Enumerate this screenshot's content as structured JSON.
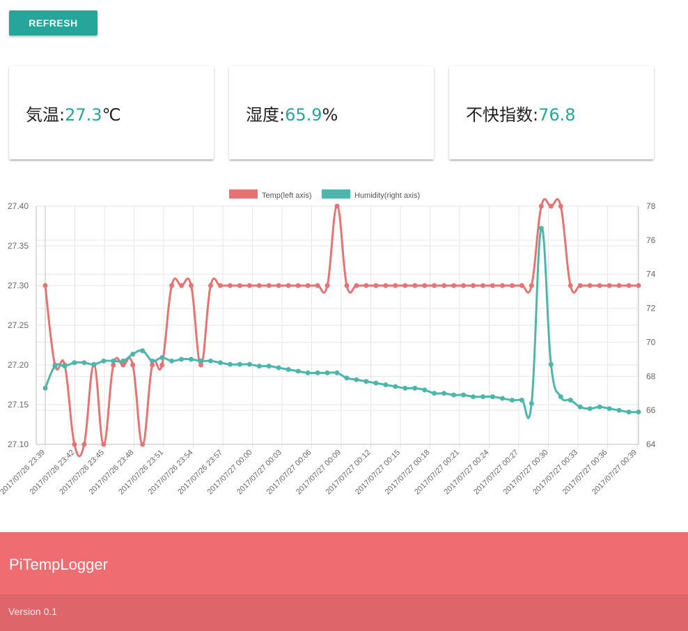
{
  "toolbar": {
    "refresh_label": "REFRESH"
  },
  "cards": {
    "temp": {
      "label": "気温:",
      "value": "27.3",
      "unit": "℃"
    },
    "humidity": {
      "label": "湿度:",
      "value": "65.9",
      "unit": "%"
    },
    "discomfort": {
      "label": "不快指数:",
      "value": "76.8",
      "unit": ""
    }
  },
  "footer": {
    "title": "PiTempLogger",
    "version": "Version 0.1"
  },
  "colors": {
    "accent": "#26a69a",
    "temp_series": "#e57373",
    "humidity_series": "#4db6ac",
    "footer": "#ef6c70",
    "footer_copy": "#de666a"
  },
  "chart_data": {
    "type": "line",
    "title": "",
    "legend": "top-center",
    "grid": true,
    "x_tick_labels": [
      "2017/07/26 23:39",
      "2017/07/26 23:42",
      "2017/07/26 23:45",
      "2017/07/26 23:48",
      "2017/07/26 23:51",
      "2017/07/26 23:54",
      "2017/07/26 23:57",
      "2017/07/27 00:00",
      "2017/07/27 00:03",
      "2017/07/27 00:06",
      "2017/07/27 00:09",
      "2017/07/27 00:12",
      "2017/07/27 00:15",
      "2017/07/27 00:18",
      "2017/07/27 00:21",
      "2017/07/27 00:24",
      "2017/07/27 00:27",
      "2017/07/27 00:30",
      "2017/07/27 00:33",
      "2017/07/27 00:36",
      "2017/07/27 00:39"
    ],
    "y_left": {
      "ticks": [
        "27.40",
        "27.35",
        "27.30",
        "27.25",
        "27.20",
        "27.15",
        "27.10"
      ],
      "ylim": [
        27.1,
        27.4
      ]
    },
    "y_right": {
      "ticks": [
        "78",
        "76",
        "74",
        "72",
        "70",
        "68",
        "66",
        "64"
      ],
      "ylim": [
        64,
        78
      ]
    },
    "series": [
      {
        "name": "Temp(left axis)",
        "axis": "left",
        "values": [
          27.3,
          27.2,
          27.2,
          27.1,
          27.1,
          27.2,
          27.1,
          27.2,
          27.2,
          27.2,
          27.1,
          27.2,
          27.2,
          27.3,
          27.3,
          27.3,
          27.2,
          27.3,
          27.3,
          27.3,
          27.3,
          27.3,
          27.3,
          27.3,
          27.3,
          27.3,
          27.3,
          27.3,
          27.3,
          27.3,
          27.4,
          27.3,
          27.3,
          27.3,
          27.3,
          27.3,
          27.3,
          27.3,
          27.3,
          27.3,
          27.3,
          27.3,
          27.3,
          27.3,
          27.3,
          27.3,
          27.3,
          27.3,
          27.3,
          27.3,
          27.3,
          27.4,
          27.4,
          27.4,
          27.3,
          27.3,
          27.3,
          27.3,
          27.3,
          27.3,
          27.3,
          27.3
        ]
      },
      {
        "name": "Humidity(right axis)",
        "axis": "right",
        "values": [
          67.3,
          68.6,
          68.6,
          68.8,
          68.8,
          68.7,
          68.9,
          68.9,
          68.9,
          69.3,
          69.5,
          68.9,
          69.1,
          68.9,
          69.0,
          69.0,
          68.9,
          68.9,
          68.8,
          68.7,
          68.7,
          68.7,
          68.6,
          68.6,
          68.5,
          68.4,
          68.3,
          68.2,
          68.2,
          68.2,
          68.2,
          67.9,
          67.8,
          67.7,
          67.6,
          67.5,
          67.4,
          67.3,
          67.3,
          67.2,
          67.0,
          67.0,
          66.9,
          66.9,
          66.8,
          66.8,
          66.8,
          66.7,
          66.6,
          66.6,
          66.4,
          76.7,
          68.7,
          66.8,
          66.6,
          66.2,
          66.1,
          66.2,
          66.1,
          66.0,
          65.9,
          65.9
        ]
      }
    ]
  }
}
